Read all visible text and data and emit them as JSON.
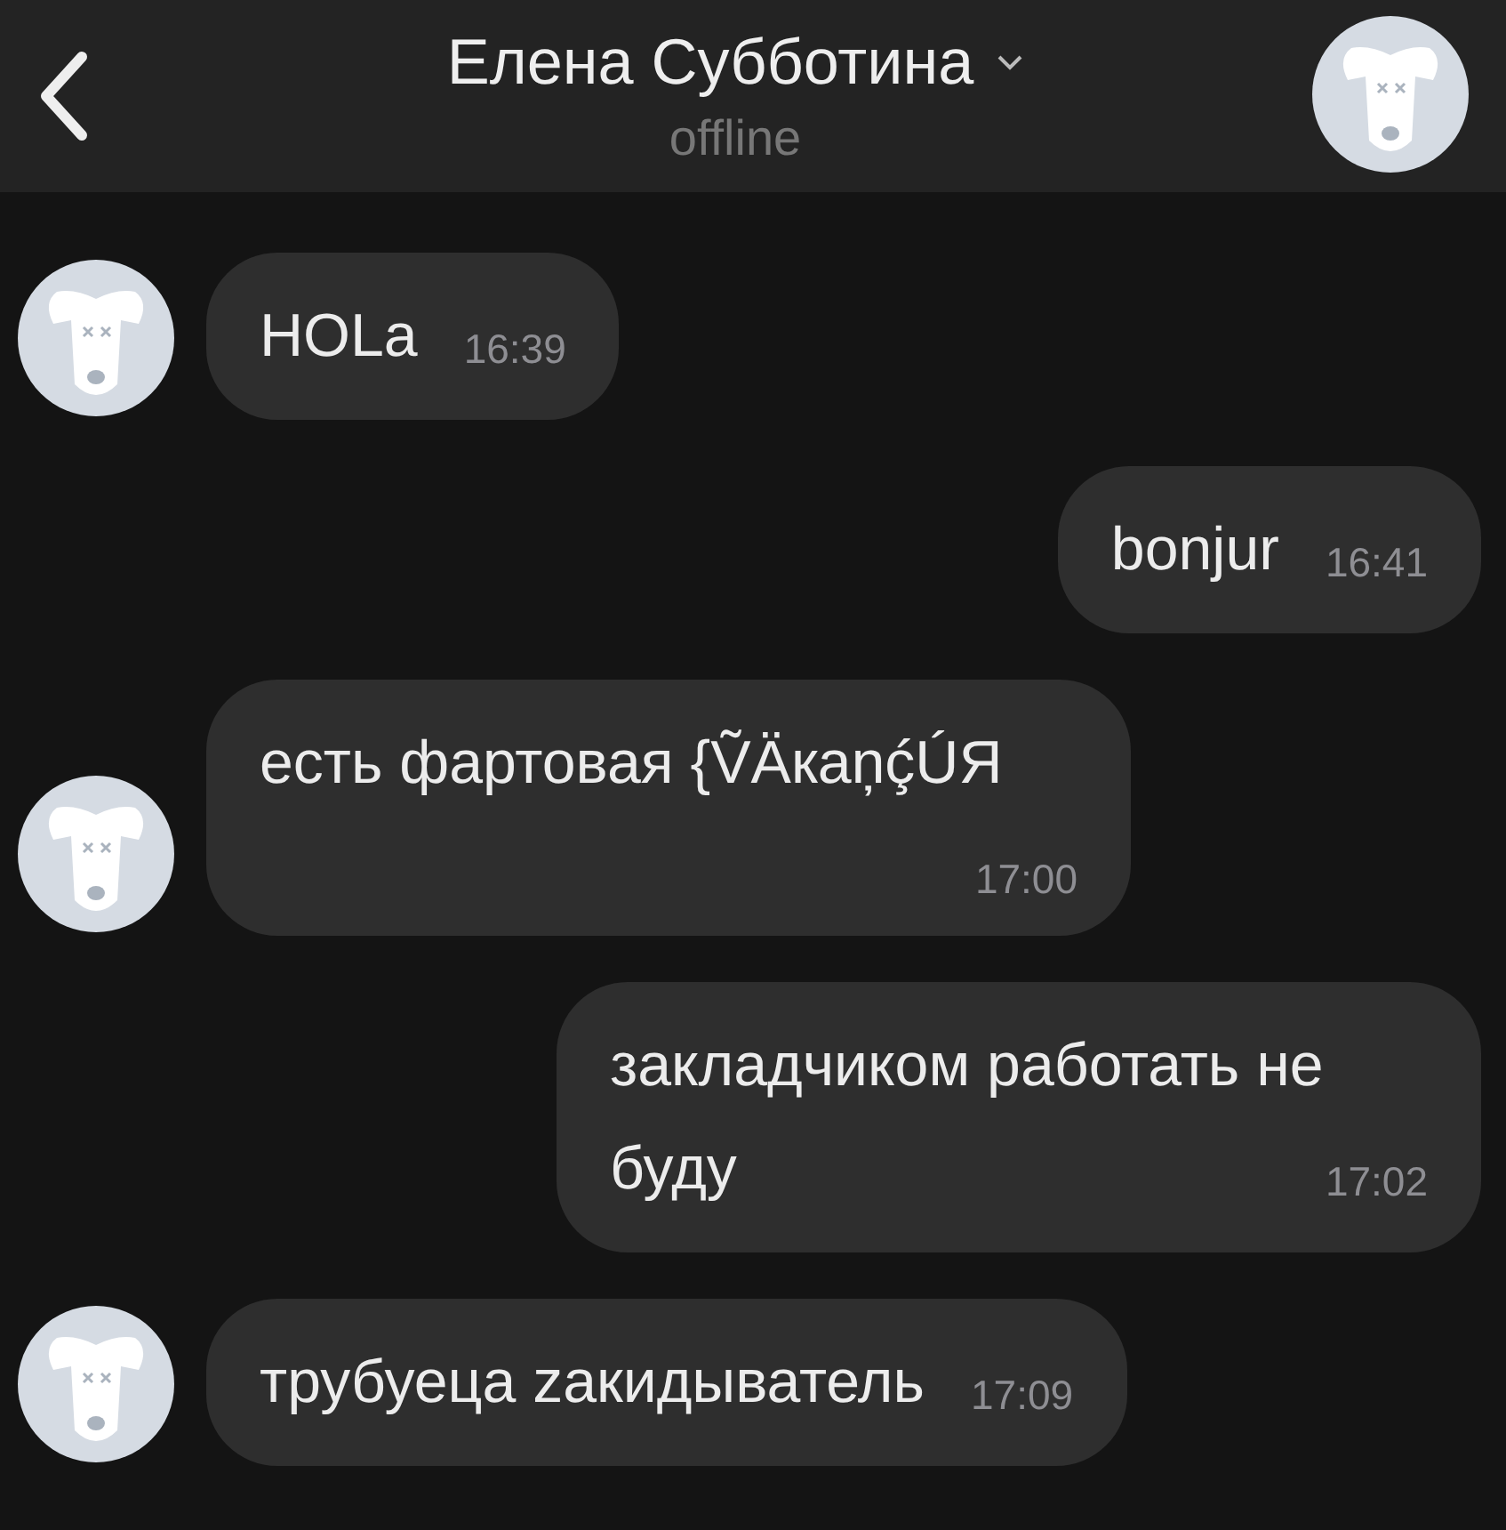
{
  "header": {
    "title": "Елена Субботина",
    "status": "offline"
  },
  "messages": [
    {
      "kind": "in",
      "text": "HOLa",
      "time": "16:39"
    },
    {
      "kind": "out",
      "text": "bonjur",
      "time": "16:41"
    },
    {
      "kind": "in",
      "text": "есть фартовая {ṼÄкaņḉÚЯ",
      "time": "17:00"
    },
    {
      "kind": "out",
      "text": "закладчиком работать не буду",
      "time": "17:02"
    },
    {
      "kind": "in",
      "text": "трубуеца zaкидыватель",
      "time": "17:09"
    }
  ]
}
